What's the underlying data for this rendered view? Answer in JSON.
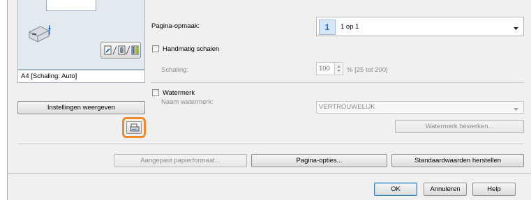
{
  "preview": {
    "caption": "A4 [Schaling: Auto]"
  },
  "left": {
    "settings_button": "Instellingen weergeven"
  },
  "layout": {
    "label": "Pagina-opmaak:",
    "badge": "1",
    "value": "1 op 1"
  },
  "scaling": {
    "checkbox_label": "Handmatig schalen",
    "field_label": "Schaling:",
    "value": "100",
    "range_hint": "% [25 tot 200]"
  },
  "watermark": {
    "checkbox_label": "Watermerk",
    "name_label": "Naam watermerk:",
    "value": "VERTROUWELIJK",
    "edit_button": "Watermerk bewerken..."
  },
  "bottom_buttons": {
    "custom_paper": "Aangepast papierformaat...",
    "page_options": "Pagina-opties...",
    "restore_defaults": "Standaardwaarden herstellen"
  },
  "dialog_buttons": {
    "ok": "OK",
    "cancel": "Annuleren",
    "help": "Help"
  },
  "colors": {
    "highlight": "#f08a2a",
    "accent": "#2a71c6",
    "badge_bg": "#d6e6f7"
  }
}
